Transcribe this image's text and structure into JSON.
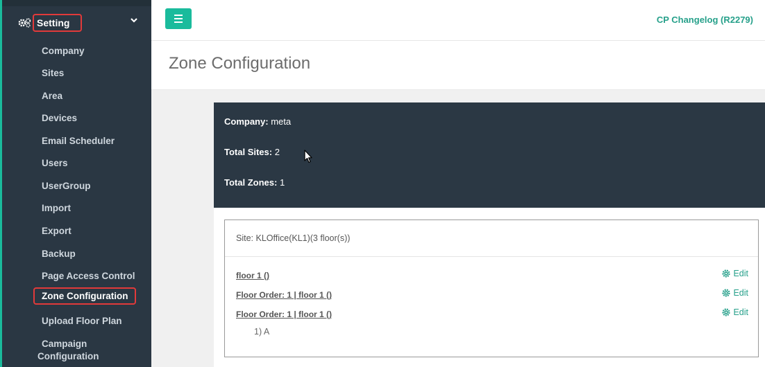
{
  "sidebar": {
    "setting_label": "Setting",
    "items": [
      {
        "label": "Company"
      },
      {
        "label": "Sites"
      },
      {
        "label": "Area"
      },
      {
        "label": "Devices"
      },
      {
        "label": "Email Scheduler"
      },
      {
        "label": "Users"
      },
      {
        "label": "UserGroup"
      },
      {
        "label": "Import"
      },
      {
        "label": "Export"
      },
      {
        "label": "Backup"
      },
      {
        "label": "Page Access Control"
      },
      {
        "label": "Zone Configuration",
        "active": true
      },
      {
        "label": "Upload Floor Plan"
      },
      {
        "label_line1": "Campaign",
        "label_line2": "Configuration"
      }
    ]
  },
  "topbar": {
    "changelog": "CP Changelog (R2279)"
  },
  "page": {
    "title": "Zone Configuration"
  },
  "summary": {
    "company_label": "Company:",
    "company_value": "meta",
    "sites_label": "Total Sites:",
    "sites_value": "2",
    "zones_label": "Total Zones:",
    "zones_value": "1"
  },
  "site": {
    "title": "Site: KLOffice(KL1)(3 floor(s))",
    "floors": [
      {
        "label": "floor 1 ()",
        "edit": "Edit"
      },
      {
        "label": "Floor Order: 1 | floor 1 ()",
        "edit": "Edit"
      },
      {
        "label": "Floor Order: 1 | floor 1 ()",
        "edit": "Edit"
      }
    ],
    "zone_item": "1) A"
  },
  "colors": {
    "sidebar_bg": "#2a3743",
    "accent": "#1abb9c",
    "highlight": "#e23a3a",
    "summary_bg": "#2b3844"
  },
  "icons": {
    "setting": "gears-icon",
    "expand": "chevron-down-icon",
    "menu": "hamburger-icon",
    "edit": "cog-icon"
  }
}
